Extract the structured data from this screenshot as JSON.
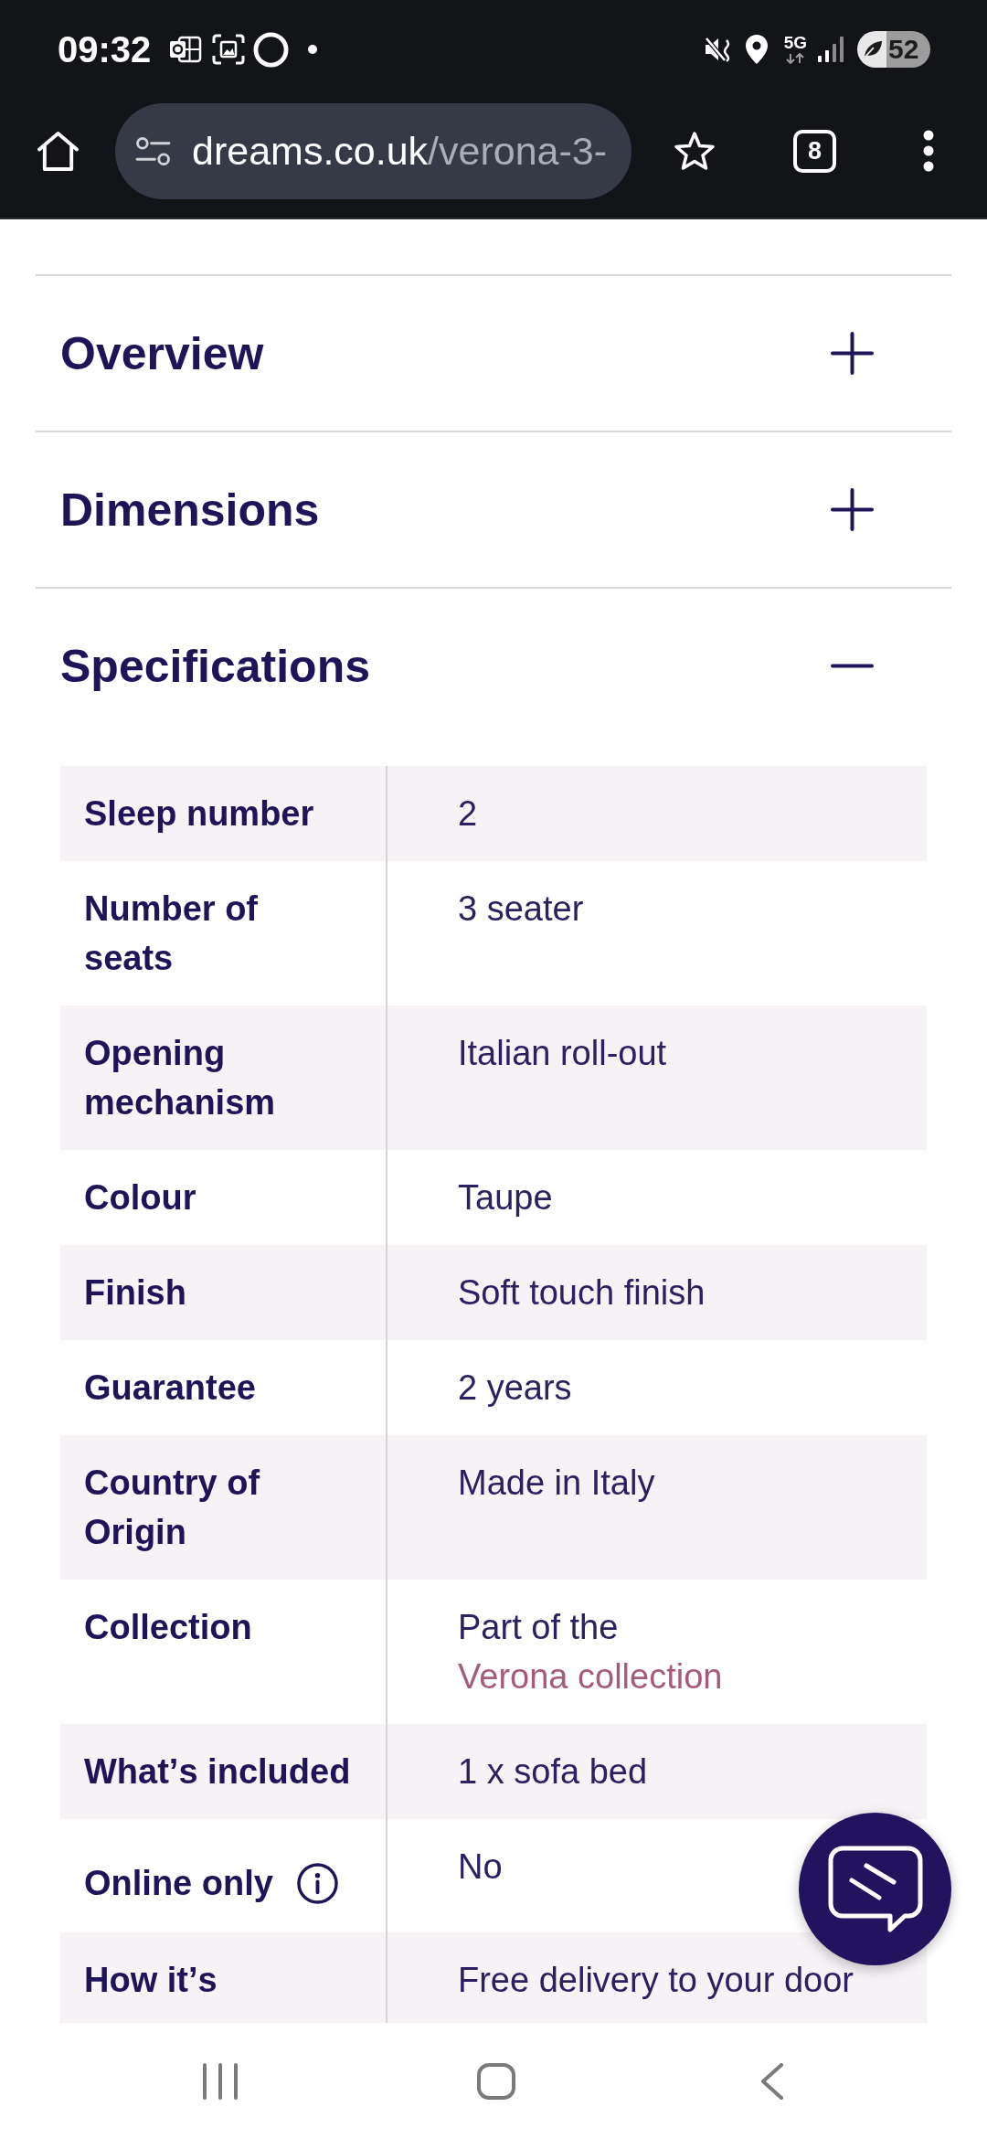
{
  "status_bar": {
    "time": "09:32",
    "network": "5G",
    "battery": "52"
  },
  "browser_toolbar": {
    "url_domain": "dreams.co.uk",
    "url_path": "/verona-3-",
    "tab_count": "8"
  },
  "accordion": [
    {
      "title": "Overview",
      "expanded": false
    },
    {
      "title": "Dimensions",
      "expanded": false
    },
    {
      "title": "Specifications",
      "expanded": true,
      "rows": [
        {
          "kind": "text",
          "label": "Sleep number",
          "value": "2"
        },
        {
          "kind": "text",
          "label": "Number of seats",
          "value": "3 seater"
        },
        {
          "kind": "text",
          "label": "Opening mechanism",
          "value": "Italian roll-out"
        },
        {
          "kind": "text",
          "label": "Colour",
          "value": "Taupe"
        },
        {
          "kind": "text",
          "label": "Finish",
          "value": "Soft touch finish"
        },
        {
          "kind": "text",
          "label": "Guarantee",
          "value": "2 years"
        },
        {
          "kind": "text",
          "label": "Country of Origin",
          "value": "Made in Italy"
        },
        {
          "kind": "link",
          "label": "Collection",
          "value": "Part of the",
          "link": "Verona collection"
        },
        {
          "kind": "text",
          "label": "What’s included",
          "value": "1 x sofa bed"
        },
        {
          "kind": "info",
          "label": "Online only",
          "value": "No"
        },
        {
          "kind": "text",
          "label": "How it’s",
          "value": "Free delivery to your door"
        }
      ]
    }
  ]
}
